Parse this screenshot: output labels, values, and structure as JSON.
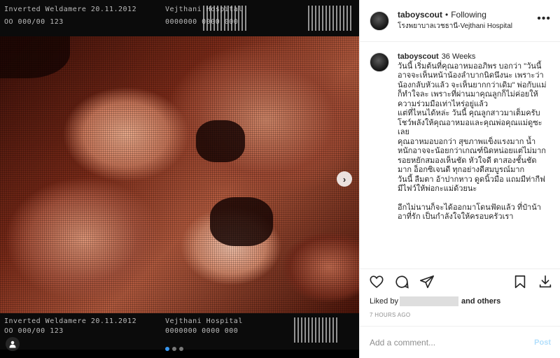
{
  "media": {
    "top_left_text": "Inverted  Weldamere  20.11.2012",
    "top_left_sub": "OO 000/00  123",
    "top_mid_text": "Vejthani  Hospital",
    "top_mid_sub": "0000000  0000  000",
    "bottom_left_text": "Inverted  Weldamere  20.11.2012",
    "bottom_left_sub": "OO 000/00  123",
    "bottom_mid_text": "Vejthani  Hospital",
    "bottom_mid_sub": "0000000  0000  000",
    "next_icon": "chevron-right-icon",
    "tag_icon": "user-tag-icon",
    "carousel_dots": 3,
    "carousel_active_index": 0
  },
  "header": {
    "username": "taboyscout",
    "separator": "•",
    "follow_status": "Following",
    "location": "โรงพยาบาลเวชธานี-Vejthani Hospital",
    "more_label": "•••"
  },
  "caption": {
    "username": "taboyscout",
    "lines": [
      "36 Weeks",
      "วันนี้ เริ่มต้นที่คุณอาหมออภิพร บอกว่า \"วันนี้ อาจจะเห็นหน้าน้องลำบากนิดนึงนะ เพราะว่าน้องกลับหัวแล้ว จะเห็นยากกว่าเดิม\" พ่อกับแม่ก็ทำใจละ เพราะที่ผ่านมาคุณลูกก็ไม่ค่อยให้ความร่วมมือเท่าไหร่อยู่แล้ว",
      "แต่ที่ไหนได้หล่ะ วันนี้ คุณลูกสาวมาเต็มครับ โชว์พลังให้คุณอาหมอและคุณพ่อคุณแม่ดูซะเลย",
      "คุณอาหมอบอกว่า สุขภาพแข็งแรงมาก น้ำหนักอาจจะน้อยกว่าเกณฑ์นิดหน่อยแต่ไม่มาก รอยหยักสมองเห็นชัด หัวใจดี ตาสองชั้นชัดมาก อ็อกซิเจนดี ทุกอย่างดีสมบูรณ์มาก",
      "วันนี้ ลืมตา อ้าปากหาว ดูดนิ้วมือ แถมมีท่ากีฟมีไฟว์ให้พ่อกะแม่ด้วยนะ",
      "",
      "อีกไม่นานก็จะได้ออกมาโดนฟัดแล้ว ที่ป๋าน้าอาที่รัก เป็นกำลังใจให้ครอบครัวเรา"
    ]
  },
  "actions": {
    "like_icon": "heart-icon",
    "comment_icon": "comment-icon",
    "share_icon": "share-icon",
    "save_icon": "bookmark-icon",
    "download_icon": "download-icon"
  },
  "likes": {
    "prefix": "Liked by",
    "suffix": "and others"
  },
  "timestamp": "7 HOURS AGO",
  "comment_box": {
    "placeholder": "Add a comment...",
    "post_label": "Post"
  }
}
